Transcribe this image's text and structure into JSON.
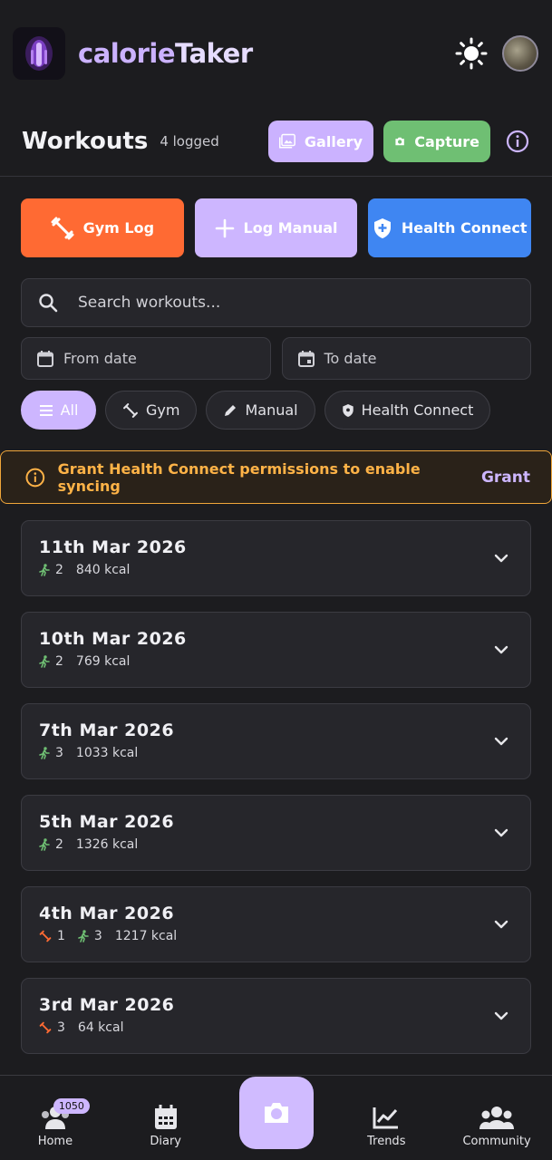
{
  "app": {
    "title_part1": "calorie",
    "title_part2": "Taker"
  },
  "header": {
    "title": "Workouts",
    "logged": "4 logged",
    "gallery_label": "Gallery",
    "capture_label": "Capture"
  },
  "actions": {
    "gym_log": "Gym Log",
    "log_manual": "Log Manual",
    "health_connect": "Health Connect"
  },
  "search": {
    "placeholder": "Search workouts..."
  },
  "dates": {
    "from": "From date",
    "to": "To date"
  },
  "filters": {
    "all": "All",
    "gym": "Gym",
    "manual": "Manual",
    "health_connect": "Health Connect"
  },
  "banner": {
    "text": "Grant Health Connect permissions to enable syncing",
    "action": "Grant"
  },
  "workouts": [
    {
      "date": "11th Mar 2026",
      "gym": null,
      "run": "2",
      "kcal": "840 kcal"
    },
    {
      "date": "10th Mar 2026",
      "gym": null,
      "run": "2",
      "kcal": "769 kcal"
    },
    {
      "date": "7th Mar 2026",
      "gym": null,
      "run": "3",
      "kcal": "1033 kcal"
    },
    {
      "date": "5th Mar 2026",
      "gym": null,
      "run": "2",
      "kcal": "1326 kcal"
    },
    {
      "date": "4th Mar 2026",
      "gym": "1",
      "run": "3",
      "kcal": "1217 kcal"
    },
    {
      "date": "3rd Mar 2026",
      "gym": "3",
      "run": null,
      "kcal": "64 kcal"
    }
  ],
  "nav": {
    "home": "Home",
    "home_badge": "1050",
    "diary": "Diary",
    "trends": "Trends",
    "community": "Community"
  },
  "colors": {
    "accent": "#cdb6ff",
    "gym": "#ff6a33",
    "health_connect": "#3f86f2",
    "capture": "#6fbf73",
    "warning": "#f0a63a",
    "run_icon": "#6fbf73"
  }
}
